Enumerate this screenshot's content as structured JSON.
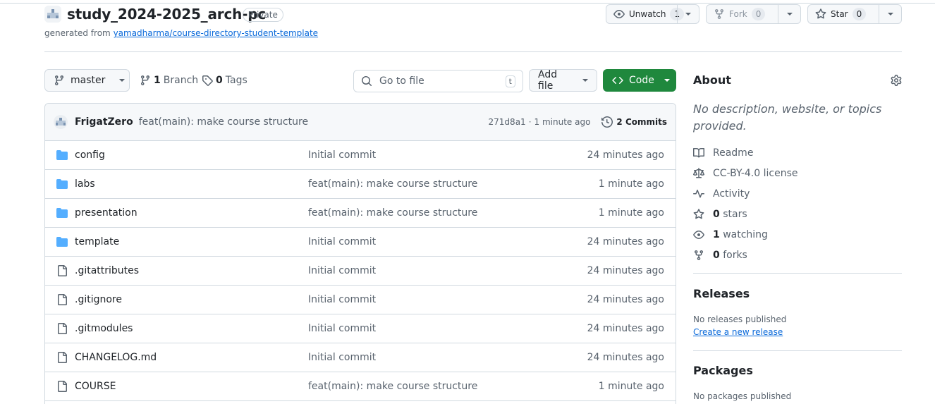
{
  "repo": {
    "name": "study_2024-2025_arch-pc",
    "visibility": "Private",
    "generated_prefix": "generated from",
    "template_link": "yamadharma/course-directory-student-template"
  },
  "actions": {
    "unwatch_label": "Unwatch",
    "watch_count": "1",
    "fork_label": "Fork",
    "fork_count": "0",
    "star_label": "Star",
    "star_count": "0"
  },
  "toolbar": {
    "branch_name": "master",
    "branch_count": "1",
    "branch_label": "Branch",
    "tag_count": "0",
    "tag_label": "Tags",
    "search_placeholder": "Go to file",
    "search_shortcut": "t",
    "add_file_label": "Add file",
    "code_label": "Code"
  },
  "latest_commit": {
    "author": "FrigatZero",
    "message": "feat(main): make course structure",
    "sha": "271d8a1",
    "separator": "·",
    "time": "1 minute ago",
    "commits_count_label": "2 Commits"
  },
  "files": [
    {
      "name": "config",
      "type": "folder",
      "message": "Initial commit",
      "age": "24 minutes ago"
    },
    {
      "name": "labs",
      "type": "folder",
      "message": "feat(main): make course structure",
      "age": "1 minute ago"
    },
    {
      "name": "presentation",
      "type": "folder",
      "message": "feat(main): make course structure",
      "age": "1 minute ago"
    },
    {
      "name": "template",
      "type": "folder",
      "message": "Initial commit",
      "age": "24 minutes ago"
    },
    {
      "name": ".gitattributes",
      "type": "file",
      "message": "Initial commit",
      "age": "24 minutes ago"
    },
    {
      "name": ".gitignore",
      "type": "file",
      "message": "Initial commit",
      "age": "24 minutes ago"
    },
    {
      "name": ".gitmodules",
      "type": "file",
      "message": "Initial commit",
      "age": "24 minutes ago"
    },
    {
      "name": "CHANGELOG.md",
      "type": "file",
      "message": "Initial commit",
      "age": "24 minutes ago"
    },
    {
      "name": "COURSE",
      "type": "file",
      "message": "feat(main): make course structure",
      "age": "1 minute ago"
    }
  ],
  "about": {
    "title": "About",
    "description": "No description, website, or topics provided.",
    "readme": "Readme",
    "license": "CC-BY-4.0 license",
    "activity": "Activity",
    "stars_count": "0",
    "stars_label": "stars",
    "watching_count": "1",
    "watching_label": "watching",
    "forks_count": "0",
    "forks_label": "forks"
  },
  "releases": {
    "title": "Releases",
    "empty": "No releases published",
    "create_link": "Create a new release"
  },
  "packages": {
    "title": "Packages",
    "empty": "No packages published"
  },
  "colors": {
    "accent_green": "#1f883d",
    "link_blue": "#0969da",
    "folder_blue": "#54aeff"
  }
}
